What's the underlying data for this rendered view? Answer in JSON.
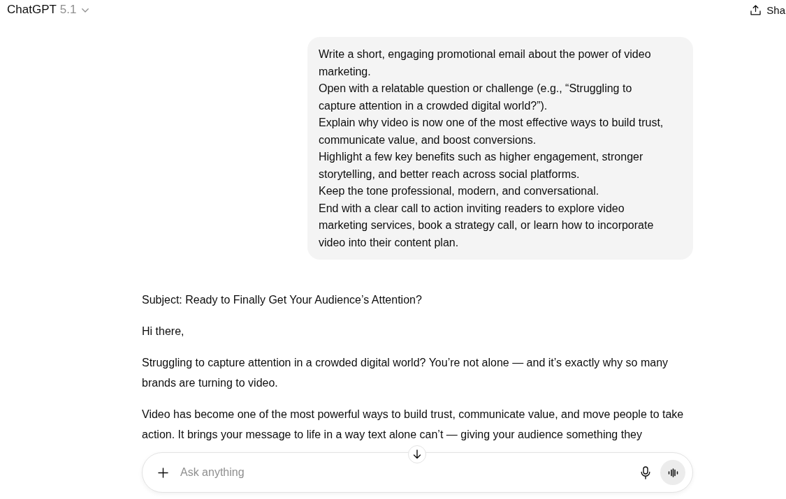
{
  "header": {
    "model_name": "ChatGPT",
    "model_version": "5.1",
    "share_label": "Sha"
  },
  "messages": [
    {
      "kind": "user",
      "lines": [
        "Write a short, engaging promotional email about the power of video marketing.",
        "Open with a relatable question or challenge (e.g., “Struggling to capture attention in a crowded digital world?”).",
        "Explain why video is now one of the most effective ways to build trust, communicate value, and boost conversions.",
        "Highlight a few key benefits such as higher engagement, stronger storytelling, and better reach across social platforms.",
        "Keep the tone professional, modern, and conversational.",
        "End with a clear call to action inviting readers to explore video marketing services, book a strategy call, or learn how to incorporate video into their content plan."
      ]
    },
    {
      "kind": "assistant",
      "lines": [
        "Subject: Ready to Finally Get Your Audience’s Attention?",
        "Hi there,",
        "Struggling to capture attention in a crowded digital world? You’re not alone — and it’s exactly why so many brands are turning to video.",
        "Video has become one of the most powerful ways to build trust, communicate value, and move people to take action. It brings your message to life in a way text alone can’t — giving your audience something they"
      ]
    }
  ],
  "composer": {
    "placeholder": "Ask anything"
  }
}
